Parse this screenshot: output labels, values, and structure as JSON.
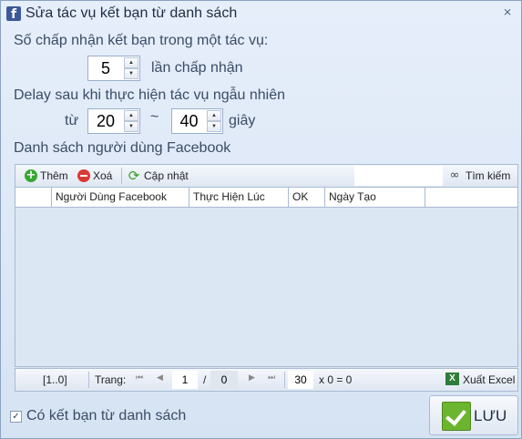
{
  "window": {
    "title": "Sửa tác vụ kết bạn từ danh sách",
    "close": "⨯"
  },
  "accept": {
    "label": "Số chấp nhận kết bạn trong một tác vụ:",
    "value": "5",
    "unit": "lần chấp nhận"
  },
  "delay": {
    "label": "Delay sau khi thực hiện tác vụ ngẫu nhiên",
    "from_label": "từ",
    "from_value": "20",
    "tilde": "~",
    "to_value": "40",
    "unit": "giây"
  },
  "list": {
    "label": "Danh sách người dùng Facebook",
    "toolbar": {
      "add": "Thêm",
      "delete": "Xoá",
      "update": "Cập nhật",
      "search": "Tìm kiếm",
      "search_value": ""
    },
    "columns": [
      "",
      "Người Dùng Facebook",
      "Thực Hiện Lúc",
      "OK",
      "Ngày Tạo",
      ""
    ]
  },
  "pager": {
    "range": "[1..0]",
    "page_label": "Trang:",
    "page": "1",
    "slash": "/",
    "total": "0",
    "per_page": "30",
    "formula": "x 0 = 0",
    "export": "Xuất Excel"
  },
  "footer": {
    "checkbox_label": "Có kết bạn từ danh sách",
    "checked": true,
    "save": "LƯU"
  },
  "icons": {
    "facebook": "facebook-icon",
    "add": "plus-circle-icon",
    "delete": "minus-circle-icon",
    "refresh": "refresh-icon",
    "search": "binoculars-icon",
    "excel": "excel-icon",
    "save": "checkmark-icon"
  },
  "colors": {
    "window_bg": "#d6e3f3",
    "facebook": "#3b5998",
    "add": "#35a82f",
    "delete": "#d93b34",
    "save_check": "#6cb52f"
  }
}
